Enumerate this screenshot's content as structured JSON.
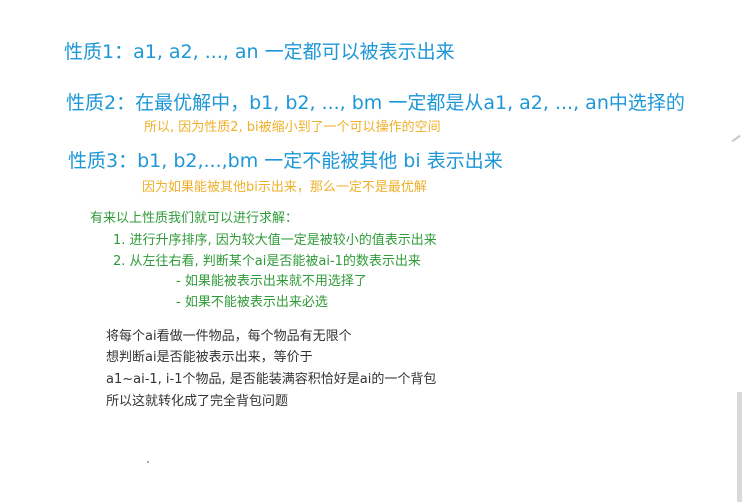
{
  "properties": [
    {
      "text": "性质1：a1, a2, ..., an 一定都可以被表示出来"
    },
    {
      "text": "性质2：在最优解中，b1, b2, ..., bm 一定都是从a1, a2, ..., an中选择的",
      "note": "所以, 因为性质2, bi被缩小到了一个可以操作的空间"
    },
    {
      "text": "性质3：b1, b2,...,bm 一定不能被其他 bi 表示出来",
      "note": "因为如果能被其他bi示出来，那么一定不是最优解"
    }
  ],
  "solution": {
    "heading": "有来以上性质我们就可以进行求解：",
    "steps": [
      "1. 进行升序排序, 因为较大值一定是被较小的值表示出来",
      "2. 从左往右看, 判断某个ai是否能被ai-1的数表示出来"
    ],
    "subpoints": [
      "- 如果能被表示出来就不用选择了",
      "- 如果不能被表示出来必选"
    ]
  },
  "notes": [
    "将每个ai看做一件物品，每个物品有无限个",
    "想判断ai是否能被表示出来，等价于",
    "a1~ai-1, i-1个物品, 是否能装满容积恰好是ai的一个背包",
    "所以这就转化成了完全背包问题"
  ],
  "colors": {
    "property": "#1e97d6",
    "note": "#efb02a",
    "solution": "#2f9b38",
    "body": "#333333"
  }
}
